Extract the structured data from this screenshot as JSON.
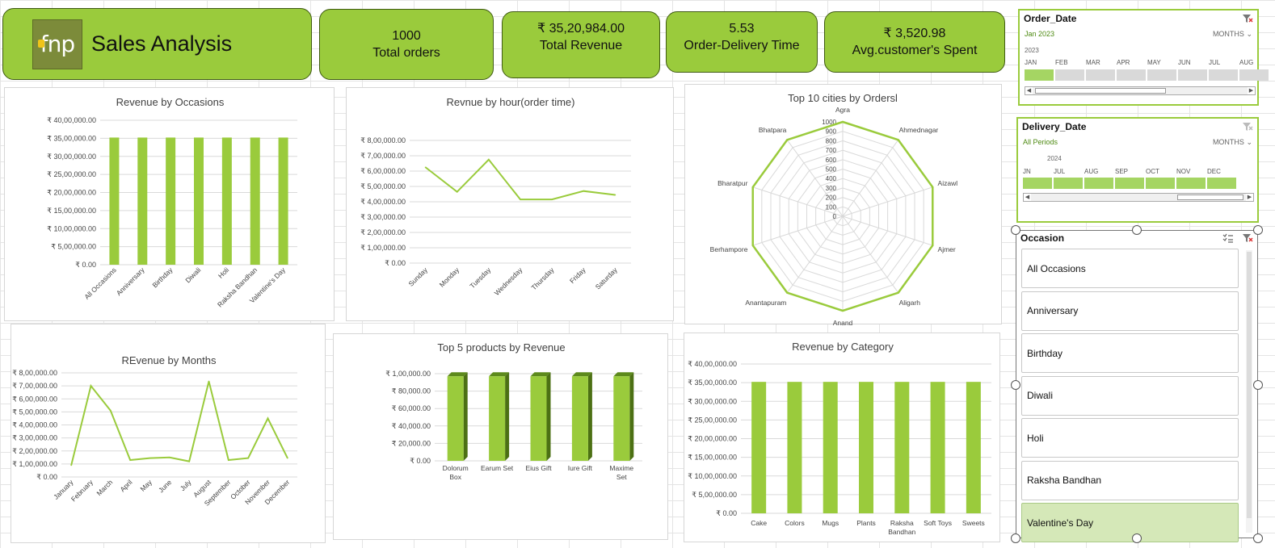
{
  "header": {
    "logo_text": "fnp",
    "title": "Sales Analysis"
  },
  "kpis": {
    "orders": {
      "value": "1000",
      "label": "Total orders"
    },
    "revenue": {
      "value": "₹ 35,20,984.00",
      "label": "Total  Revenue"
    },
    "delivery": {
      "value": "5.53",
      "label": "Order-Delivery Time"
    },
    "avg": {
      "value": "₹ 3,520.98",
      "label": "Avg.customer's Spent"
    }
  },
  "slicers": {
    "order_date": {
      "title": "Order_Date",
      "selection": "Jan 2023",
      "level": "MONTHS",
      "year": "2023",
      "months": [
        "JAN",
        "FEB",
        "MAR",
        "APR",
        "MAY",
        "JUN",
        "JUL",
        "AUG"
      ],
      "filter_icon": "clear-filter-icon"
    },
    "delivery_date": {
      "title": "Delivery_Date",
      "selection": "All Periods",
      "level": "MONTHS",
      "year": "2024",
      "months": [
        "JN",
        "JUL",
        "AUG",
        "SEP",
        "OCT",
        "NOV",
        "DEC"
      ],
      "filter_icon": "clear-filter-icon"
    },
    "occasion": {
      "title": "Occasion",
      "items": [
        "All Occasions",
        "Anniversary",
        "Birthday",
        "Diwali",
        "Holi",
        "Raksha Bandhan",
        "Valentine's Day"
      ],
      "selected": "Valentine's Day",
      "icons": [
        "multi-select-icon",
        "clear-filter-icon"
      ]
    }
  },
  "colors": {
    "accent": "#9acb3c",
    "series": "#9acb3c",
    "series_dark": "#5d8a1c",
    "selected_item": "#d5e8b8"
  },
  "chart_data": [
    {
      "id": "occasions",
      "type": "bar",
      "title": "Revenue by Occasions",
      "categories": [
        "All Occasions",
        "Anniversary",
        "Birthday",
        "Diwali",
        "Holi",
        "Raksha Bandhan",
        "Valentine's Day"
      ],
      "values": [
        3520984,
        3520984,
        3520984,
        3520984,
        3520984,
        3520984,
        3520984
      ],
      "ylim": [
        0,
        4000000
      ],
      "yticks": [
        "₹ 0.00",
        "₹ 5,00,000.00",
        "₹ 10,00,000.00",
        "₹ 15,00,000.00",
        "₹ 20,00,000.00",
        "₹ 25,00,000.00",
        "₹ 30,00,000.00",
        "₹ 35,00,000.00",
        "₹ 40,00,000.00"
      ],
      "grid": true
    },
    {
      "id": "hour",
      "type": "line",
      "title": "Revnue by hour(order time)",
      "categories": [
        "Sunday",
        "Monday",
        "Tuesday",
        "Wednesday",
        "Thursday",
        "Friday",
        "Saturday"
      ],
      "values": [
        625000,
        465000,
        675000,
        415000,
        415000,
        470000,
        445000
      ],
      "ylim": [
        0,
        800000
      ],
      "yticks": [
        "₹ 0.00",
        "₹ 1,00,000.00",
        "₹ 2,00,000.00",
        "₹ 3,00,000.00",
        "₹ 4,00,000.00",
        "₹ 5,00,000.00",
        "₹ 6,00,000.00",
        "₹ 7,00,000.00",
        "₹ 8,00,000.00"
      ],
      "grid": true
    },
    {
      "id": "cities",
      "type": "radar",
      "title": "Top 10 cities by Ordersl",
      "categories": [
        "Agra",
        "Ahmednagar",
        "Aizawl",
        "Ajmer",
        "Aligarh",
        "Anand",
        "Anantapuram",
        "Berhampore",
        "Bharatpur",
        "Bhatpara"
      ],
      "values": [
        1000,
        1000,
        1000,
        1000,
        1000,
        1000,
        1000,
        1000,
        1000,
        1000
      ],
      "rmax": 1000,
      "rticks": [
        "0",
        "100",
        "200",
        "300",
        "400",
        "500",
        "600",
        "700",
        "800",
        "900",
        "1000"
      ]
    },
    {
      "id": "months",
      "type": "line",
      "title": "REvenue by Months",
      "categories": [
        "January",
        "February",
        "March",
        "April",
        "May",
        "June",
        "July",
        "August",
        "September",
        "October",
        "November",
        "December"
      ],
      "values": [
        90000,
        700000,
        510000,
        130000,
        145000,
        150000,
        120000,
        735000,
        130000,
        145000,
        450000,
        145000
      ],
      "ylim": [
        0,
        800000
      ],
      "yticks": [
        "₹ 0.00",
        "₹ 1,00,000.00",
        "₹ 2,00,000.00",
        "₹ 3,00,000.00",
        "₹ 4,00,000.00",
        "₹ 5,00,000.00",
        "₹ 6,00,000.00",
        "₹ 7,00,000.00",
        "₹ 8,00,000.00"
      ],
      "grid": true
    },
    {
      "id": "products",
      "type": "bar",
      "title": "Top 5 products by Revenue",
      "categories": [
        [
          "Dolorum",
          "Box"
        ],
        [
          "Earum Set"
        ],
        [
          "Eius Gift"
        ],
        [
          "Iure Gift"
        ],
        [
          "Maxime",
          "Set"
        ]
      ],
      "values": [
        97000,
        97000,
        97000,
        97000,
        97000
      ],
      "ylim": [
        0,
        100000
      ],
      "yticks": [
        "₹ 0.00",
        "₹ 20,000.00",
        "₹ 40,000.00",
        "₹ 60,000.00",
        "₹ 80,000.00",
        "₹ 1,00,000.00"
      ],
      "grid": true,
      "style_3d": true
    },
    {
      "id": "category",
      "type": "bar",
      "title": "Revenue by Category",
      "categories": [
        [
          "Cake"
        ],
        [
          "Colors"
        ],
        [
          "Mugs"
        ],
        [
          "Plants"
        ],
        [
          "Raksha",
          "Bandhan"
        ],
        [
          "Soft Toys"
        ],
        [
          "Sweets"
        ]
      ],
      "values": [
        3520984,
        3520984,
        3520984,
        3520984,
        3520984,
        3520984,
        3520984
      ],
      "ylim": [
        0,
        4000000
      ],
      "yticks": [
        "₹ 0.00",
        "₹ 5,00,000.00",
        "₹ 10,00,000.00",
        "₹ 15,00,000.00",
        "₹ 20,00,000.00",
        "₹ 25,00,000.00",
        "₹ 30,00,000.00",
        "₹ 35,00,000.00",
        "₹ 40,00,000.00"
      ],
      "grid": true
    }
  ]
}
